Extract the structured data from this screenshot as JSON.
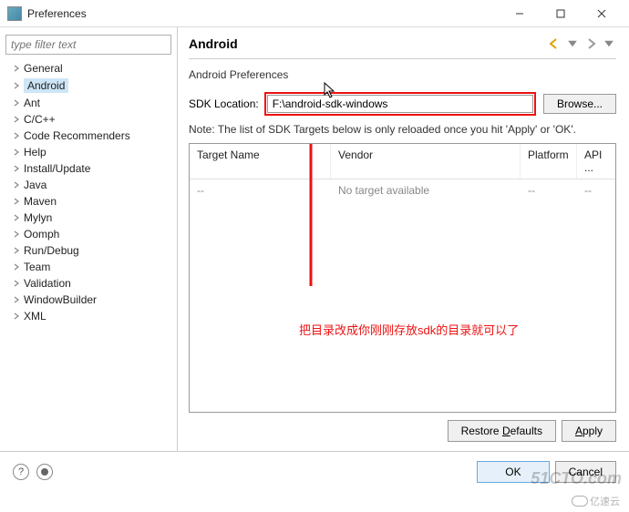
{
  "window": {
    "title": "Preferences"
  },
  "sidebar": {
    "filter_placeholder": "type filter text",
    "items": [
      {
        "label": "General"
      },
      {
        "label": "Android"
      },
      {
        "label": "Ant"
      },
      {
        "label": "C/C++"
      },
      {
        "label": "Code Recommenders"
      },
      {
        "label": "Help"
      },
      {
        "label": "Install/Update"
      },
      {
        "label": "Java"
      },
      {
        "label": "Maven"
      },
      {
        "label": "Mylyn"
      },
      {
        "label": "Oomph"
      },
      {
        "label": "Run/Debug"
      },
      {
        "label": "Team"
      },
      {
        "label": "Validation"
      },
      {
        "label": "WindowBuilder"
      },
      {
        "label": "XML"
      }
    ],
    "selected": "Android"
  },
  "content": {
    "title": "Android",
    "subtitle": "Android Preferences",
    "sdk_label": "SDK Location:",
    "sdk_value": "F:\\android-sdk-windows",
    "browse": "Browse...",
    "note": "Note: The list of SDK Targets below is only reloaded once you hit 'Apply' or 'OK'.",
    "table": {
      "headers": {
        "target": "Target Name",
        "vendor": "Vendor",
        "platform": "Platform",
        "api": "API ..."
      },
      "rows": [
        {
          "target": "--",
          "vendor": "No target available",
          "platform": "--",
          "api": "--"
        }
      ]
    },
    "restore": "Restore Defaults",
    "apply": "Apply",
    "annotation": "把目录改成你刚刚存放sdk的目录就可以了"
  },
  "bottom": {
    "ok": "OK",
    "cancel": "Cancel"
  },
  "watermark": {
    "w1": "51CTO.com",
    "w2": "亿速云"
  }
}
